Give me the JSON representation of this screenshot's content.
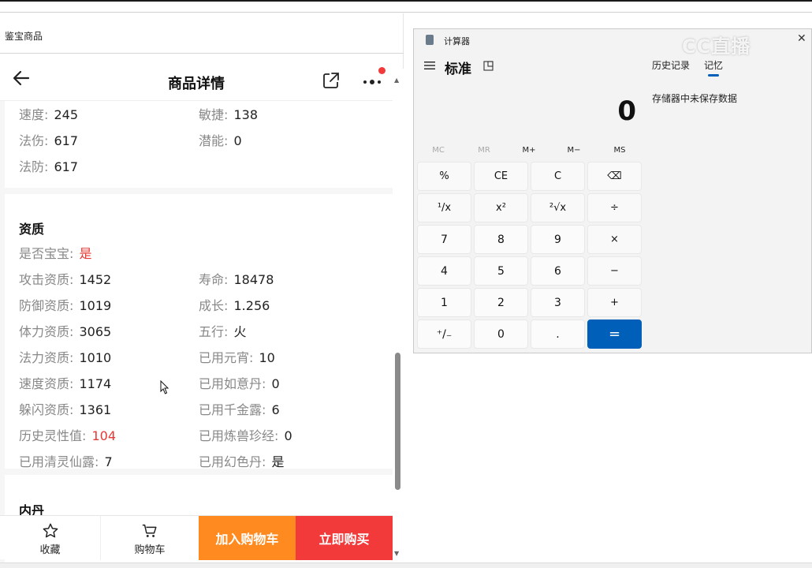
{
  "window": {
    "title": "鉴宝商品"
  },
  "app": {
    "header_title": "商品详情"
  },
  "stats": [
    {
      "label": "速度:",
      "value": "245"
    },
    {
      "label": "敏捷:",
      "value": "138"
    },
    {
      "label": "法伤:",
      "value": "617"
    },
    {
      "label": "潜能:",
      "value": "0"
    },
    {
      "label": "法防:",
      "value": "617"
    }
  ],
  "aptitude": {
    "title": "资质",
    "is_baby": {
      "label": "是否宝宝:",
      "value": "是"
    },
    "rows": [
      {
        "label": "攻击资质:",
        "value": "1452"
      },
      {
        "label": "寿命:",
        "value": "18478"
      },
      {
        "label": "防御资质:",
        "value": "1019"
      },
      {
        "label": "成长:",
        "value": "1.256"
      },
      {
        "label": "体力资质:",
        "value": "3065"
      },
      {
        "label": "五行:",
        "value": "火"
      },
      {
        "label": "法力资质:",
        "value": "1010"
      },
      {
        "label": "已用元宵:",
        "value": "10"
      },
      {
        "label": "速度资质:",
        "value": "1174"
      },
      {
        "label": "已用如意丹:",
        "value": "0"
      },
      {
        "label": "躲闪资质:",
        "value": "1361"
      },
      {
        "label": "已用千金露:",
        "value": "6"
      },
      {
        "label": "历史灵性值:",
        "value": "104"
      },
      {
        "label": "已用炼兽珍经:",
        "value": "0"
      },
      {
        "label": "已用清灵仙露:",
        "value": "7"
      },
      {
        "label": "已用幻色丹:",
        "value": "是"
      }
    ]
  },
  "neidan": {
    "title": "内丹"
  },
  "bottom_bar": {
    "favorite_label": "收藏",
    "cart_label": "购物车",
    "add_cart_label": "加入购物车",
    "buy_now_label": "立即购买",
    "add_cart_color": "#ff8a1f",
    "buy_now_color": "#f23a3a"
  },
  "calculator": {
    "title": "计算器",
    "mode": "标准",
    "tab_history": "历史记录",
    "tab_memory": "记忆",
    "display": "0",
    "memory_text": "存储器中未保存数据",
    "watermark": "CC直播",
    "memory_buttons": [
      "MC",
      "MR",
      "M+",
      "M−",
      "MS"
    ],
    "keys": [
      "%",
      "CE",
      "C",
      "⌫",
      "¹/x",
      "x²",
      "²√x",
      "÷",
      "7",
      "8",
      "9",
      "×",
      "4",
      "5",
      "6",
      "−",
      "1",
      "2",
      "3",
      "+",
      "⁺/₋",
      "0",
      ".",
      "="
    ],
    "accent_color": "#005fb8"
  }
}
